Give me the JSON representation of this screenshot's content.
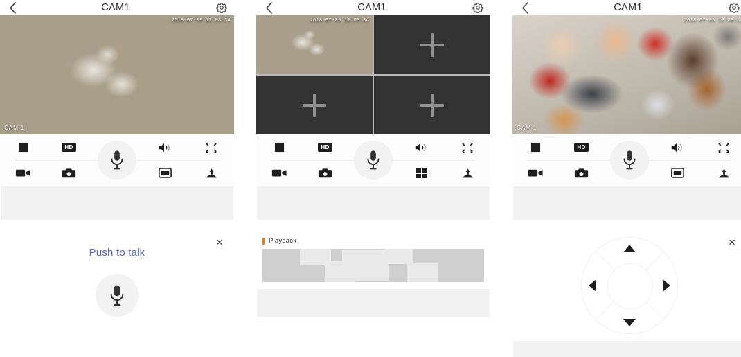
{
  "app": {
    "accent_orange": "#ef7911",
    "accent_blue": "#5566c7",
    "icon_dark": "#1e1e1e",
    "panel_bg": "#ffffff",
    "band_gray": "#f2f2f2"
  },
  "panels": [
    {
      "id": "panel-live-talk",
      "header": {
        "back": "‹",
        "title": "CAM1",
        "gear": "gear-icon"
      },
      "video": {
        "mode": "single",
        "scene": "garden-dining-table",
        "camera_label": "CAM 1",
        "timestamp": "2018-07-09 12:08:34"
      },
      "toolbar": {
        "stop_label": "stop-icon",
        "quality_label": "HD",
        "mic_label": "microphone-icon",
        "volume_label": "speaker-icon",
        "fullscreen_label": "fullscreen-icon",
        "record_label": "video-record-icon",
        "snapshot_label": "camera-icon",
        "layout_label": "single-view-icon",
        "ptz_label": "ptz-icon"
      },
      "sheet": {
        "type": "push-to-talk",
        "title": "Push to talk",
        "close": "×",
        "button_icon": "microphone-icon"
      }
    },
    {
      "id": "panel-quad-playback",
      "header": {
        "back": "‹",
        "title": "CAM1",
        "gear": "gear-icon"
      },
      "video": {
        "mode": "quad",
        "cells": [
          {
            "state": "active",
            "scene": "garden-dining-table",
            "camera_label": "CAM 1",
            "timestamp": "2018-07-09 12:08:34"
          },
          {
            "state": "empty",
            "add": "+"
          },
          {
            "state": "empty",
            "add": "+"
          },
          {
            "state": "empty",
            "add": "+"
          }
        ]
      },
      "toolbar": {
        "stop_label": "stop-icon",
        "quality_label": "HD",
        "mic_label": "microphone-icon",
        "volume_label": "speaker-icon",
        "fullscreen_label": "fullscreen-icon",
        "record_label": "video-record-icon",
        "snapshot_label": "camera-icon",
        "layout_label": "quad-view-icon",
        "ptz_label": "ptz-icon"
      },
      "sheet": {
        "type": "playback",
        "title": "Playback",
        "segments": [
          {
            "left": "17%",
            "top": "0%",
            "width": "14%",
            "height": "50%"
          },
          {
            "left": "28%",
            "top": "38%",
            "width": "14%",
            "height": "62%"
          },
          {
            "left": "36%",
            "top": "4%",
            "width": "21%",
            "height": "92%"
          },
          {
            "left": "55%",
            "top": "0%",
            "width": "13%",
            "height": "46%"
          },
          {
            "left": "65%",
            "top": "44%",
            "width": "14%",
            "height": "56%"
          }
        ]
      }
    },
    {
      "id": "panel-ptz",
      "header": {
        "back": "‹",
        "title": "CAM1",
        "gear": "gear-icon"
      },
      "video": {
        "mode": "single",
        "scene": "supermarket-checkout",
        "camera_label": "CAM 1",
        "timestamp": "2018-07-09 12:08:34"
      },
      "toolbar": {
        "stop_label": "stop-icon",
        "quality_label": "HD",
        "mic_label": "microphone-icon",
        "volume_label": "speaker-icon",
        "fullscreen_label": "fullscreen-icon",
        "record_label": "video-record-icon",
        "snapshot_label": "camera-icon",
        "layout_label": "single-view-icon",
        "ptz_label": "ptz-icon"
      },
      "sheet": {
        "type": "ptz-pad",
        "close": "×",
        "up": "▲",
        "down": "▼",
        "left": "◀",
        "right": "▶"
      }
    }
  ]
}
